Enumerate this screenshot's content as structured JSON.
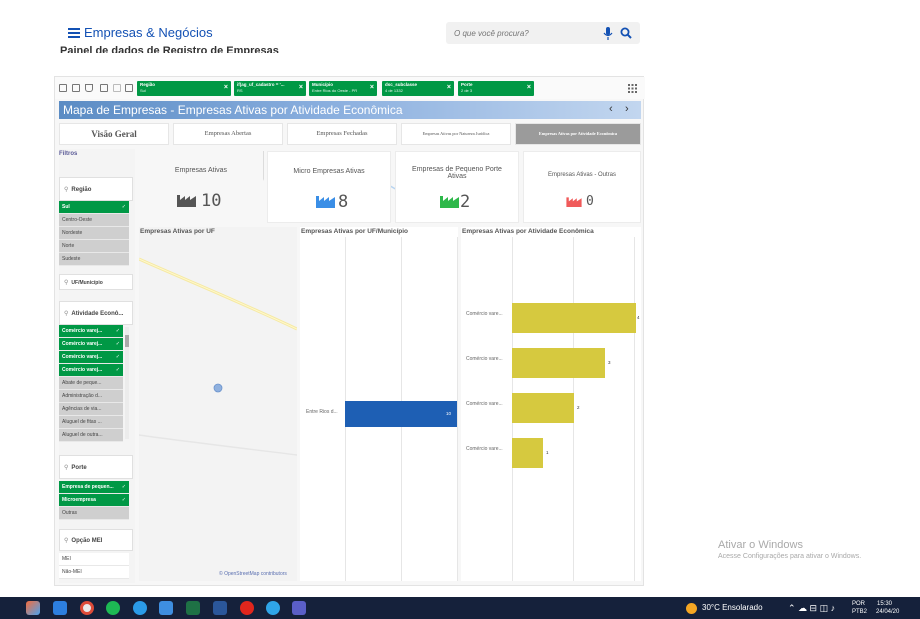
{
  "site": {
    "title": "Empresas & Negócios",
    "search_placeholder": "O que você procura?",
    "page_subtitle": "Painel de dados de Registro de Empresas"
  },
  "filters_bar": [
    {
      "key": "Região",
      "value": "Sul"
    },
    {
      "key": "if(ag_uf_cadastro = '...",
      "value": "RS"
    },
    {
      "key": "Município",
      "value": "Entre Rios do Oeste - PR"
    },
    {
      "key": "dsc_subclasse",
      "value": "4 de 1332"
    },
    {
      "key": "Porte",
      "value": "2 de 3"
    }
  ],
  "banner": {
    "title": "Mapa de Empresas - Empresas Ativas por Atividade Econômica",
    "prev": "‹",
    "next": "›"
  },
  "tabs": [
    {
      "label": "Visão Geral"
    },
    {
      "label": "Empresas Abertas"
    },
    {
      "label": "Empresas Fechadas"
    },
    {
      "label": "Empresas Ativas por Natureza Jurídica"
    },
    {
      "label": "Empresas Ativas por Atividade Econômica"
    }
  ],
  "filter_panel": {
    "title": "Filtros",
    "regiao": {
      "label": "Região",
      "items": [
        {
          "label": "Sul",
          "state": "selected"
        },
        {
          "label": "Centro-Oeste",
          "state": "alternative"
        },
        {
          "label": "Nordeste",
          "state": "alternative"
        },
        {
          "label": "Norte",
          "state": "alternative"
        },
        {
          "label": "Sudeste",
          "state": "alternative"
        }
      ]
    },
    "uf": {
      "label": "UF/Município"
    },
    "atividade": {
      "label": "Atividade Econô...",
      "items": [
        {
          "label": "Comércio varej...",
          "state": "selected"
        },
        {
          "label": "Comércio varej...",
          "state": "selected"
        },
        {
          "label": "Comércio varej...",
          "state": "selected"
        },
        {
          "label": "Comércio varej...",
          "state": "selected"
        },
        {
          "label": "Abate de peque...",
          "state": "alternative"
        },
        {
          "label": "Administração d...",
          "state": "alternative"
        },
        {
          "label": "Agências de via...",
          "state": "alternative"
        },
        {
          "label": "Aluguel de fitas ...",
          "state": "alternative"
        },
        {
          "label": "Aluguel de outra...",
          "state": "alternative"
        }
      ]
    },
    "porte": {
      "label": "Porte",
      "items": [
        {
          "label": "Empresa de pequen...",
          "state": "selected"
        },
        {
          "label": "Microempresa",
          "state": "selected"
        },
        {
          "label": "Outras",
          "state": "alternative"
        }
      ]
    },
    "mei": {
      "label": "Opção MEI",
      "items": [
        {
          "label": "MEI",
          "state": "possible"
        },
        {
          "label": "Não-MEI",
          "state": "possible"
        }
      ]
    },
    "check": "✓"
  },
  "kpis": [
    {
      "label": "Empresas Ativas",
      "value": "10",
      "color": "#555555"
    },
    {
      "label": "Micro Empresas Ativas",
      "value": "8",
      "color": "#3a8ee6"
    },
    {
      "label": "Empresas de Pequeno Porte Ativas",
      "value": "2",
      "color": "#2eb84a"
    },
    {
      "label": "Empresas Ativas - Outras",
      "value": "0",
      "color": "#f05a5a"
    }
  ],
  "panels": {
    "uf": {
      "title": "Empresas Ativas por UF",
      "credit": "© OpenStreetMap contributors"
    },
    "municipio": {
      "title": "Empresas Ativas por UF/Município",
      "bar_label": "Entre Rios d...",
      "bar_value": "10",
      "value": 10,
      "max": 10
    },
    "atividade": {
      "title": "Empresas Ativas por Atividade Econômica",
      "bars": [
        {
          "label": "Comércio vare...",
          "value": 4
        },
        {
          "label": "Comércio vare...",
          "value": 3
        },
        {
          "label": "Comércio vare...",
          "value": 2
        },
        {
          "label": "Comércio vare...",
          "value": 1
        }
      ],
      "max": 4
    }
  },
  "windows": {
    "activate_title": "Ativar o Windows",
    "activate_sub": "Acesse Configurações para ativar o Windows.",
    "weather": "30°C  Ensolarado",
    "lang1": "POR",
    "lang2": "PTB2",
    "time": "15:30",
    "date": "24/04/20"
  },
  "colors": {
    "selected_green": "#009845",
    "bar_yellow": "#d6c93f",
    "bar_blue": "#1e5fb4",
    "link_blue": "#1351b4"
  }
}
